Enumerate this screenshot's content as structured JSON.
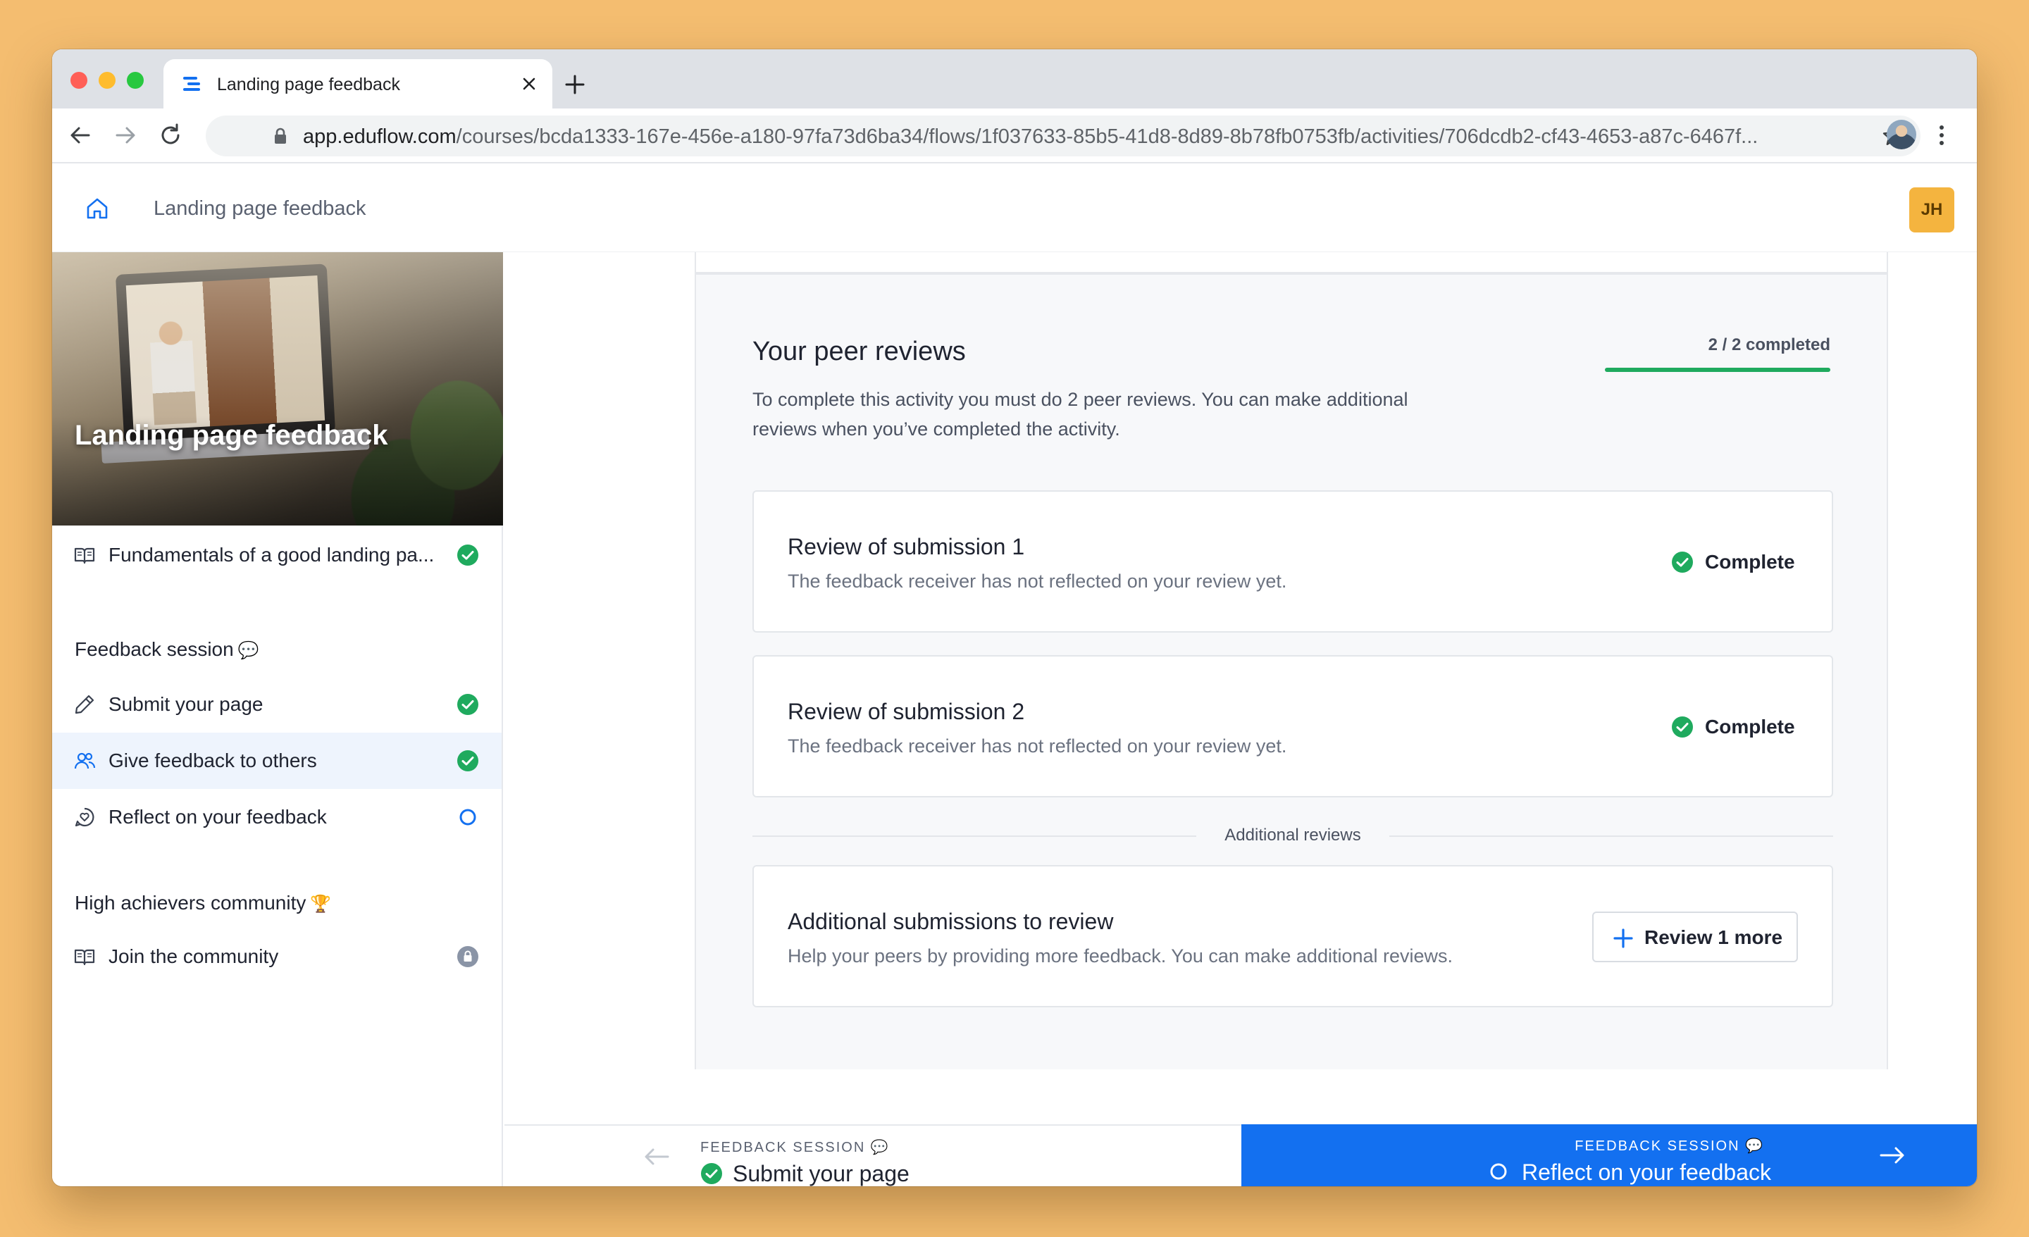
{
  "browser": {
    "tab_title": "Landing page feedback",
    "url_host": "app.eduflow.com",
    "url_path": "/courses/bcda1333-167e-456e-a180-97fa73d6ba34/flows/1f037633-85b5-41d8-8d89-8b78fb0753fb/activities/706dcdb2-cf43-4653-a87c-6467f..."
  },
  "header": {
    "title": "Landing page feedback",
    "avatar_initials": "JH"
  },
  "sidebar": {
    "hero_title": "Landing page feedback",
    "items": [
      {
        "label": "Fundamentals of a good landing pa...",
        "icon": "book-icon",
        "status": "complete"
      }
    ],
    "sections": [
      {
        "title": "Feedback session",
        "emoji": "💬",
        "items": [
          {
            "label": "Submit your page",
            "icon": "pencil-icon",
            "status": "complete"
          },
          {
            "label": "Give feedback to others",
            "icon": "users-icon",
            "status": "complete",
            "active": true
          },
          {
            "label": "Reflect on your feedback",
            "icon": "chat-heart-icon",
            "status": "pending"
          }
        ]
      },
      {
        "title": "High achievers community",
        "emoji": "🏆",
        "items": [
          {
            "label": "Join the community",
            "icon": "book-icon",
            "status": "locked"
          }
        ]
      }
    ]
  },
  "main": {
    "heading": "Your peer reviews",
    "description": "To complete this activity you must do 2 peer reviews. You can make additional reviews when you’ve completed the activity.",
    "progress_label": "2 / 2 completed",
    "progress_fraction": 1.0,
    "reviews": [
      {
        "title": "Review of submission 1",
        "subtitle": "The feedback receiver has not reflected on your review yet.",
        "status": "Complete"
      },
      {
        "title": "Review of submission 2",
        "subtitle": "The feedback receiver has not reflected on your review yet.",
        "status": "Complete"
      }
    ],
    "divider_label": "Additional reviews",
    "additional": {
      "title": "Additional submissions to review",
      "subtitle": "Help your peers by providing more feedback. You can make additional reviews.",
      "button_label": "Review 1 more"
    }
  },
  "footer": {
    "prev": {
      "kicker": "FEEDBACK SESSION",
      "kicker_emoji": "💬",
      "label": "Submit your page"
    },
    "next": {
      "kicker": "FEEDBACK SESSION",
      "kicker_emoji": "💬",
      "label": "Reflect on your feedback"
    }
  },
  "colors": {
    "accent": "#1370F0",
    "success": "#1FAA5E",
    "avatar": "#F4B43F",
    "page_background": "#F4BD70"
  }
}
